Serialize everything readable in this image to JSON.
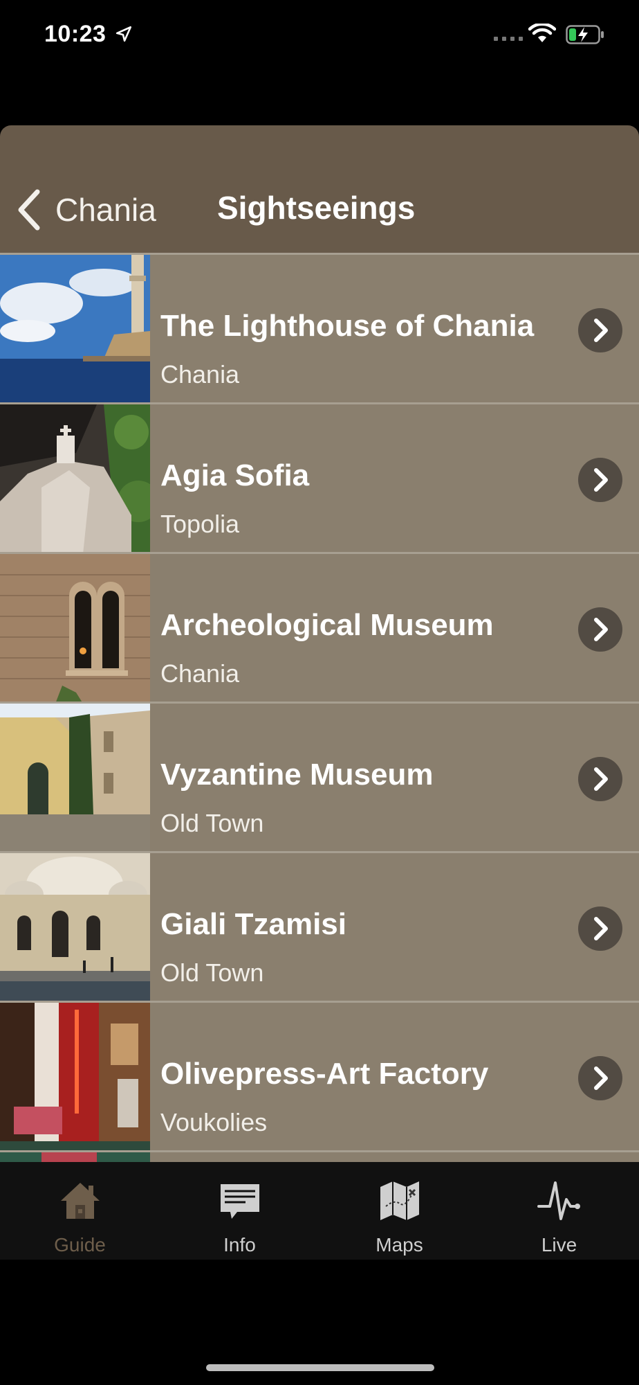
{
  "status_bar": {
    "time": "10:23"
  },
  "nav": {
    "back_label": "Chania",
    "title": "Sightseeings"
  },
  "items": [
    {
      "title": "The Lighthouse of Chania",
      "subtitle": "Chania"
    },
    {
      "title": "Agia Sofia",
      "subtitle": "Topolia"
    },
    {
      "title": "Archeological Museum",
      "subtitle": "Chania"
    },
    {
      "title": "Vyzantine Museum",
      "subtitle": "Old Town"
    },
    {
      "title": "Giali Tzamisi",
      "subtitle": "Old Town"
    },
    {
      "title": "Olivepress-Art Factory",
      "subtitle": "Voukolies"
    }
  ],
  "tabs": [
    {
      "label": "Guide",
      "icon": "house-icon",
      "active": true
    },
    {
      "label": "Info",
      "icon": "info-card-icon",
      "active": false
    },
    {
      "label": "Maps",
      "icon": "map-icon",
      "active": false
    },
    {
      "label": "Live",
      "icon": "pulse-icon",
      "active": false
    }
  ],
  "colors": {
    "navbar": "#685a4a",
    "row_bg": "#8a7f6e",
    "row_separator": "#a79f91",
    "chevron_bg": "#524b43",
    "tab_active": "#6e5e4b",
    "tab_inactive": "#cfcfcf",
    "tabbar_bg": "#111111"
  }
}
